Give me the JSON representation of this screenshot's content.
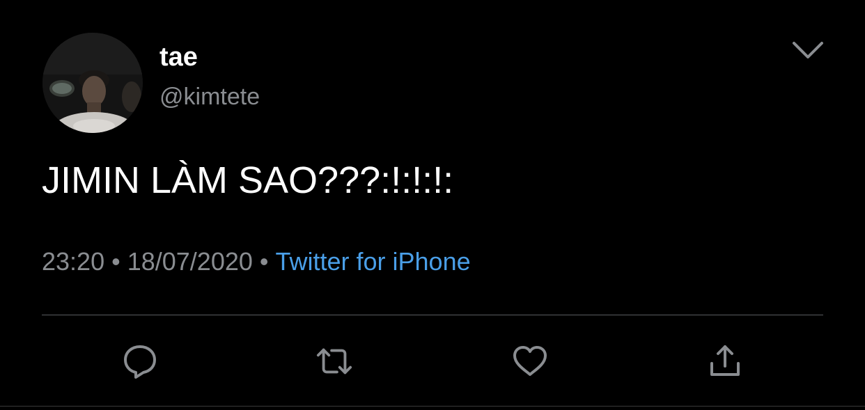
{
  "user": {
    "display_name": "tae",
    "handle": "@kimtete"
  },
  "tweet": {
    "text": "JIMIN LÀM SAO???:!:!:!:",
    "time": "23:20",
    "date": "18/07/2020",
    "separator": "•",
    "source": "Twitter for iPhone"
  },
  "icons": {
    "menu": "chevron-down-icon",
    "reply": "reply-icon",
    "retweet": "retweet-icon",
    "like": "heart-icon",
    "share": "share-icon"
  },
  "colors": {
    "background": "#000000",
    "primary_text": "#ffffff",
    "secondary_text": "#8a8d91",
    "link": "#4a9fe8",
    "icon": "#8a8d91"
  }
}
